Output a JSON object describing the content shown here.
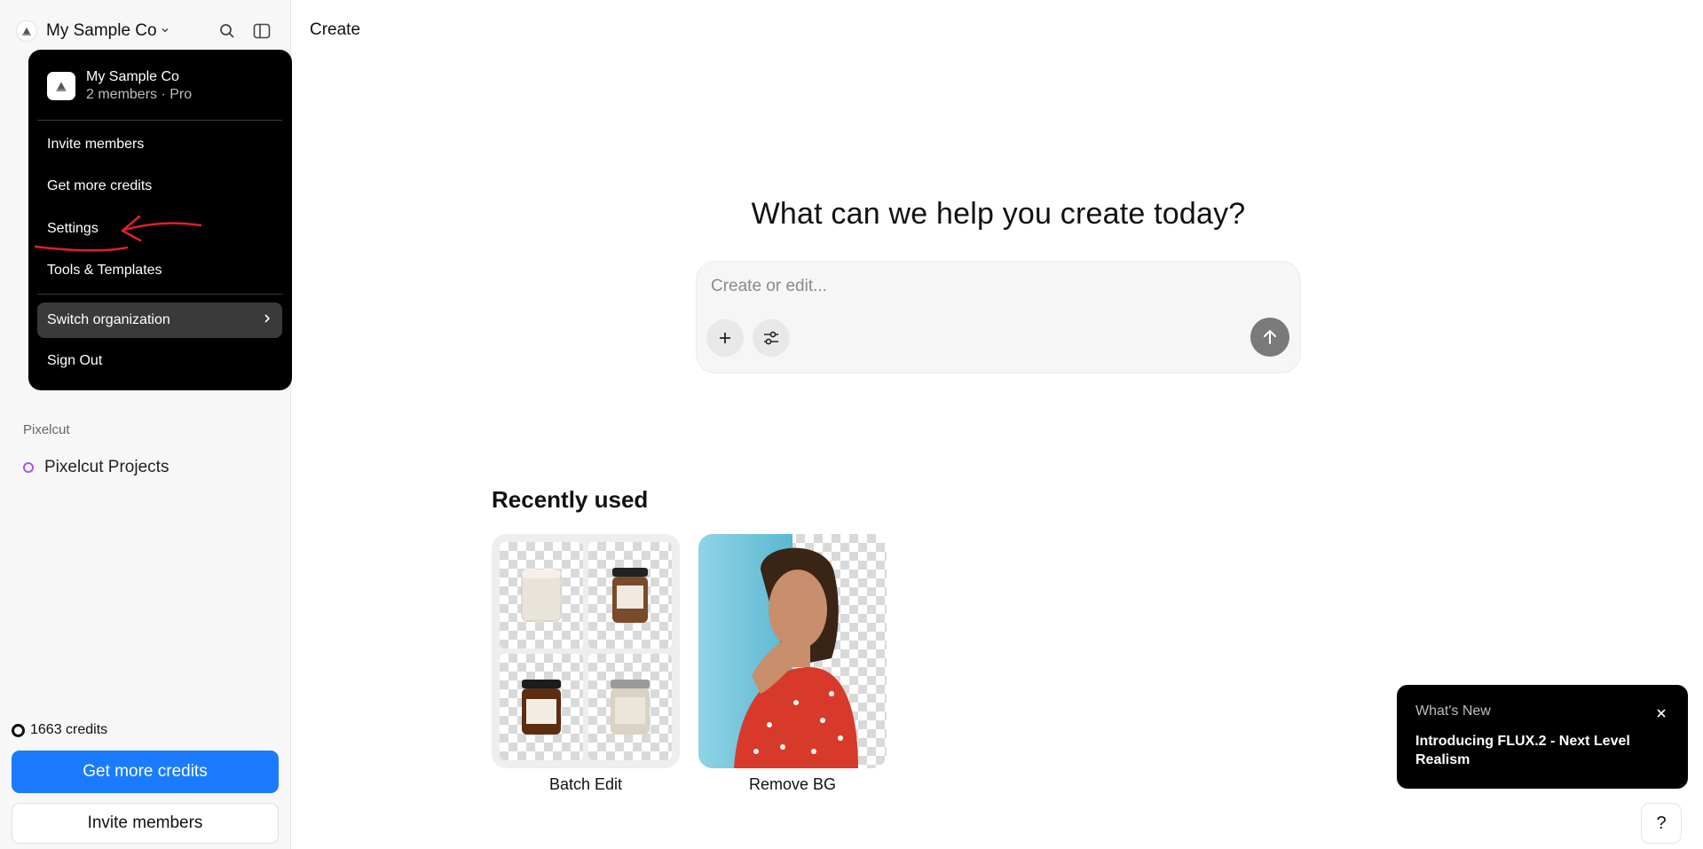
{
  "sidebar": {
    "org_name": "My Sample Co",
    "section_pixelcut": "Pixelcut",
    "pixelcut_projects": "Pixelcut Projects",
    "credits": "1663 credits",
    "get_more_credits": "Get more credits",
    "invite_members": "Invite members",
    "icons": [
      "org-logo-icon",
      "chevron-down-icon",
      "search-icon",
      "sidebar-toggle-icon"
    ]
  },
  "menu": {
    "org_name": "My Sample Co",
    "org_sub": "2 members · Pro",
    "items": [
      "Invite members",
      "Get more credits",
      "Settings",
      "Tools & Templates"
    ],
    "switch_org": "Switch organization",
    "sign_out": "Sign Out"
  },
  "main": {
    "title": "Create",
    "hero": "What can we help you create today?",
    "prompt_placeholder": "Create or edit...",
    "recent_title": "Recently used",
    "cards": [
      "Batch Edit",
      "Remove BG"
    ]
  },
  "toast": {
    "title": "What's New",
    "body": "Introducing FLUX.2 - Next Level Realism"
  },
  "help_label": "?",
  "colors": {
    "accent": "#1a7bff",
    "menu_bg": "#000000",
    "annotation": "#e0202a",
    "project_ring": "#a855f7"
  }
}
